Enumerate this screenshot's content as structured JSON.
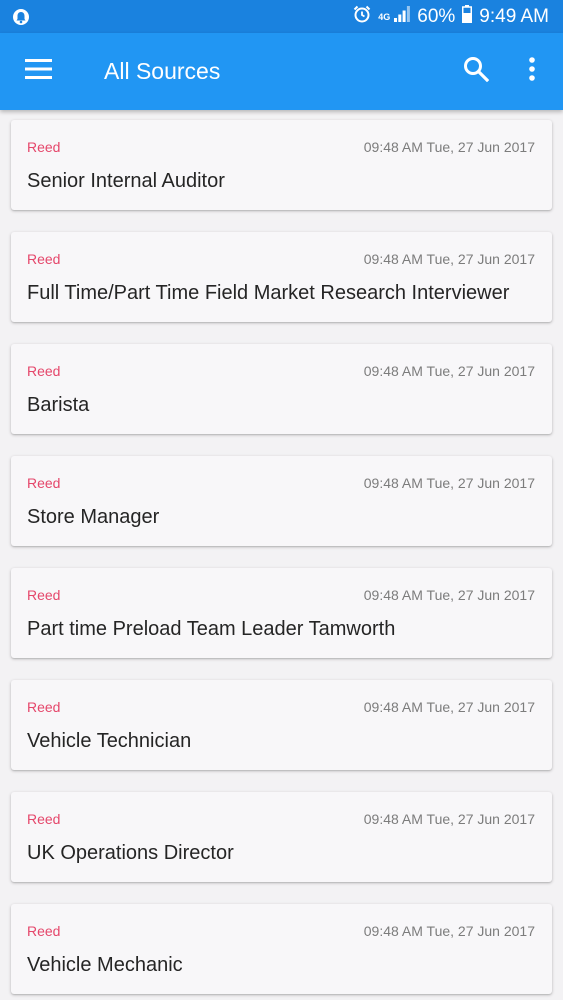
{
  "status_bar": {
    "network": "4G",
    "battery_percent": "60%",
    "time": "9:49 AM",
    "icons": [
      "notification-icon",
      "alarm-icon",
      "signal-icon",
      "battery-icon"
    ]
  },
  "app_bar": {
    "title": "All Sources",
    "icons": [
      "menu-icon",
      "search-icon",
      "more-vert-icon"
    ],
    "color": "#2196f3"
  },
  "colors": {
    "status_bar": "#1a82df",
    "source_label": "#e5476b",
    "background": "#f3f2f4"
  },
  "feed": {
    "items": [
      {
        "source": "Reed",
        "time": "09:48 AM Tue, 27 Jun 2017",
        "title": "Senior Internal Auditor"
      },
      {
        "source": "Reed",
        "time": "09:48 AM Tue, 27 Jun 2017",
        "title": "Full Time/Part Time Field Market Research Interviewer"
      },
      {
        "source": "Reed",
        "time": "09:48 AM Tue, 27 Jun 2017",
        "title": "Barista"
      },
      {
        "source": "Reed",
        "time": "09:48 AM Tue, 27 Jun 2017",
        "title": "Store Manager"
      },
      {
        "source": "Reed",
        "time": "09:48 AM Tue, 27 Jun 2017",
        "title": "Part time Preload Team Leader Tamworth"
      },
      {
        "source": "Reed",
        "time": "09:48 AM Tue, 27 Jun 2017",
        "title": "Vehicle Technician"
      },
      {
        "source": "Reed",
        "time": "09:48 AM Tue, 27 Jun 2017",
        "title": "UK Operations Director"
      },
      {
        "source": "Reed",
        "time": "09:48 AM Tue, 27 Jun 2017",
        "title": "Vehicle Mechanic"
      }
    ]
  }
}
